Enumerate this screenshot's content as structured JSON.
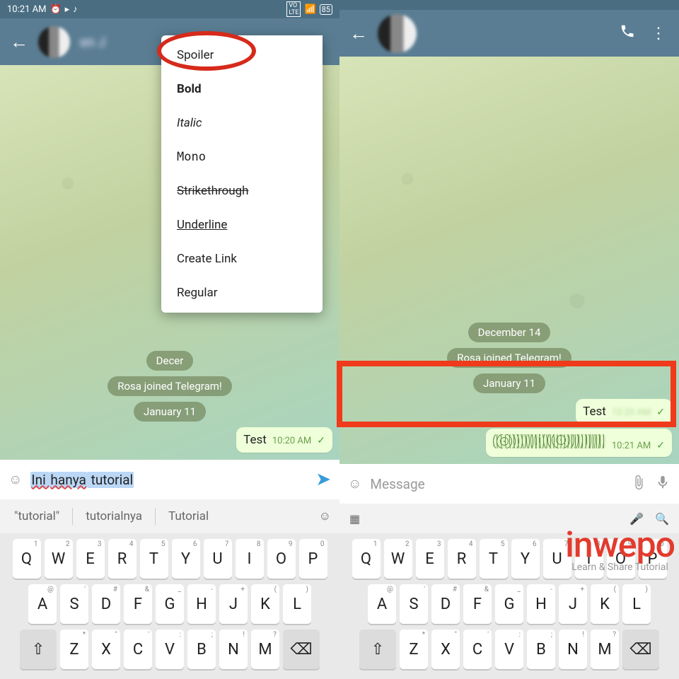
{
  "status": {
    "time": "10:21 AM",
    "battery": "85"
  },
  "left": {
    "menu": [
      "Spoiler",
      "Bold",
      "Italic",
      "Mono",
      "Strikethrough",
      "Underline",
      "Create Link",
      "Regular"
    ],
    "pill_date1_partial": "Decer",
    "pill_join": "Rosa joined Telegram!",
    "pill_date2": "January 11",
    "bubble_text": "Test",
    "bubble_time": "10:20 AM",
    "input_head": "Ini ",
    "input_sel": "hanya",
    "input_tail": " tutorial",
    "suggest": [
      "\"tutorial\"",
      "tutorialnya",
      "Tutorial"
    ]
  },
  "right": {
    "pill_date1": "December 14",
    "pill_join": "Rosa joined Telegram!",
    "pill_date2": "January 11",
    "bubble1_text": "Test",
    "bubble1_time_partial": "",
    "bubble2_time": "10:21 AM",
    "input_placeholder": "Message"
  },
  "kb": {
    "r1": [
      "Q",
      "W",
      "E",
      "R",
      "T",
      "Y",
      "U",
      "I",
      "O",
      "P"
    ],
    "r2": [
      "A",
      "S",
      "D",
      "F",
      "G",
      "H",
      "J",
      "K",
      "L"
    ],
    "r3": [
      "Z",
      "X",
      "C",
      "V",
      "B",
      "N",
      "M"
    ],
    "hints1": [
      "1",
      "2",
      "3",
      "4",
      "5",
      "6",
      "7",
      "8",
      "9",
      "0"
    ],
    "hints2": [
      "@",
      "'",
      "#",
      "&",
      "_",
      "-",
      "+",
      "(",
      ")"
    ],
    "hints3": [
      "*",
      "\"",
      "'",
      ":",
      ";",
      "!",
      "?"
    ]
  },
  "wm": {
    "big": "inwepo",
    "small": "Learn & Share Tutorial"
  }
}
